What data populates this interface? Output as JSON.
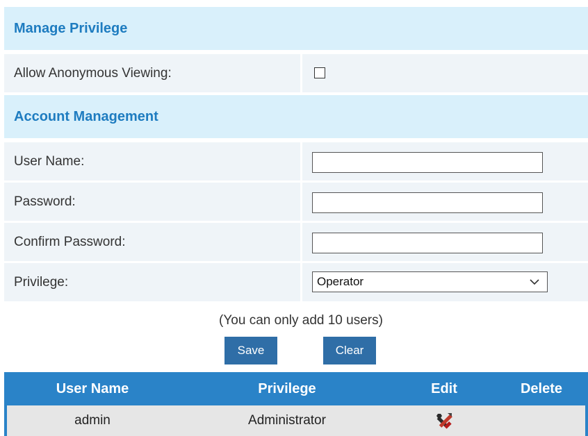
{
  "manage_privilege": {
    "title": "Manage Privilege",
    "anonymous_label": "Allow Anonymous Viewing:",
    "anonymous_checked": false
  },
  "account_management": {
    "title": "Account Management",
    "user_name_label": "User Name:",
    "user_name_value": "",
    "password_label": "Password:",
    "password_value": "",
    "confirm_password_label": "Confirm Password:",
    "confirm_password_value": "",
    "privilege_label": "Privilege:",
    "privilege_selected": "Operator",
    "note": "(You can only add 10 users)",
    "save_label": "Save",
    "clear_label": "Clear"
  },
  "users_table": {
    "headers": [
      "User Name",
      "Privilege",
      "Edit",
      "Delete"
    ],
    "rows": [
      {
        "user_name": "admin",
        "privilege": "Administrator",
        "edit_icon": "tools-icon",
        "delete_icon": ""
      }
    ]
  },
  "colors": {
    "section_bg": "#d9f0fb",
    "section_title": "#1e7cc0",
    "row_bg": "#eff4f8",
    "button_bg": "#2f6ea7",
    "table_header_bg": "#2a83c8",
    "table_row_bg": "#e6e6e6"
  }
}
